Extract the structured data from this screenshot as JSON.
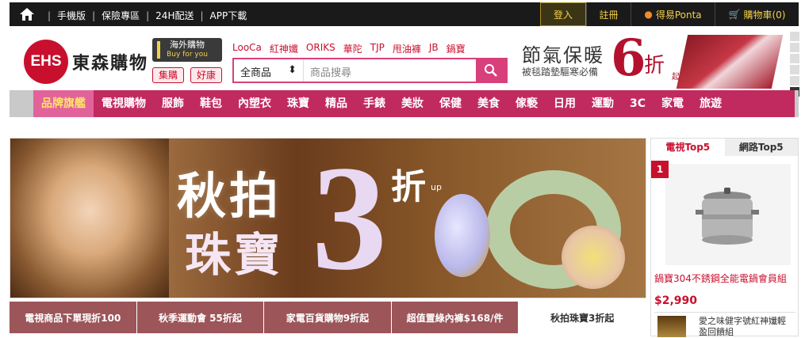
{
  "topbar": {
    "links": [
      "手機版",
      "保險專區",
      "24H配送",
      "APP下載"
    ],
    "login": "登入",
    "register": "註冊",
    "ponta": "得易Ponta",
    "cart": "購物車(0)"
  },
  "header": {
    "logo_mark": "EHS",
    "logo_text": "東森購物",
    "overseas_title": "海外購物",
    "overseas_sub": "Buy for you",
    "chip1": "集購",
    "chip2": "好康",
    "brand_links": [
      "LooCa",
      "紅神孅",
      "ORIKS",
      "華陀",
      "TJP",
      "甩油褲",
      "JB",
      "鍋寶"
    ],
    "search_category": "全商品",
    "search_placeholder": "商品搜尋",
    "promo_line1": "節氣保暖",
    "promo_line2": "被毯踏墊驅寒必備",
    "promo_big": "6",
    "promo_zhe": "折",
    "promo_qi": "起"
  },
  "nav": [
    "品牌旗艦",
    "電視購物",
    "服飾",
    "鞋包",
    "內塑衣",
    "珠寶",
    "精品",
    "手錶",
    "美妝",
    "保健",
    "美食",
    "傢褻",
    "日用",
    "運動",
    "3C",
    "家電",
    "旅遊"
  ],
  "banner": {
    "line1": "秋拍",
    "line2": "珠寶",
    "number": "3",
    "zhe": "折",
    "up": "up"
  },
  "tabs": [
    "電視商品下單現折100",
    "秋季運動會 55折起",
    "家電百貨購物9折起",
    "超值置綠內褲$168/件",
    "秋拍珠寶3折起"
  ],
  "side": {
    "tab1": "電視Top5",
    "tab2": "網路Top5",
    "rank": "1",
    "product_name": "鍋寶304不銹鋼全能電鍋會員組",
    "price": "$2,990",
    "product2_name": "愛之味健字號紅神孅輕盈回饋組"
  }
}
